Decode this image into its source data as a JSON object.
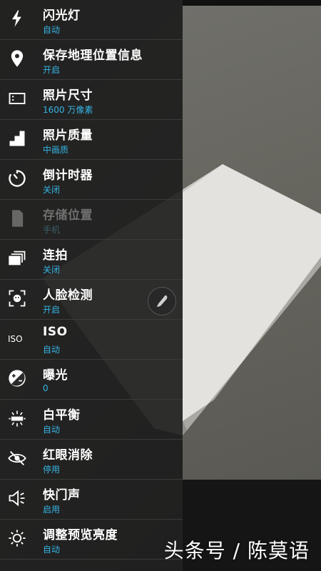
{
  "settings": [
    {
      "title": "闪光灯",
      "value": "自动",
      "icon": "flash-icon"
    },
    {
      "title": "保存地理位置信息",
      "value": "开启",
      "icon": "location-icon"
    },
    {
      "title": "照片尺寸",
      "value": "1600 万像素",
      "icon": "photo-size-icon"
    },
    {
      "title": "照片质量",
      "value": "中画质",
      "icon": "quality-icon"
    },
    {
      "title": "倒计时器",
      "value": "关闭",
      "icon": "timer-icon"
    },
    {
      "title": "存储位置",
      "value": "手机",
      "icon": "sd-card-icon"
    },
    {
      "title": "连拍",
      "value": "关闭",
      "icon": "burst-icon"
    },
    {
      "title": "人脸检测",
      "value": "开启",
      "icon": "face-detect-icon"
    },
    {
      "title": "ISO",
      "value": "自动",
      "icon": "iso-icon"
    },
    {
      "title": "曝光",
      "value": "0",
      "icon": "exposure-icon"
    },
    {
      "title": "白平衡",
      "value": "自动",
      "icon": "white-balance-icon"
    },
    {
      "title": "红眼消除",
      "value": "停用",
      "icon": "red-eye-icon"
    },
    {
      "title": "快门声",
      "value": "启用",
      "icon": "shutter-sound-icon"
    },
    {
      "title": "调整预览亮度",
      "value": "自动",
      "icon": "brightness-icon"
    }
  ],
  "watermark": "头条号 / 陈莫语",
  "colors": {
    "accent": "#35b5e5",
    "title": "#ffffff",
    "divider": "#3b3b3b"
  }
}
